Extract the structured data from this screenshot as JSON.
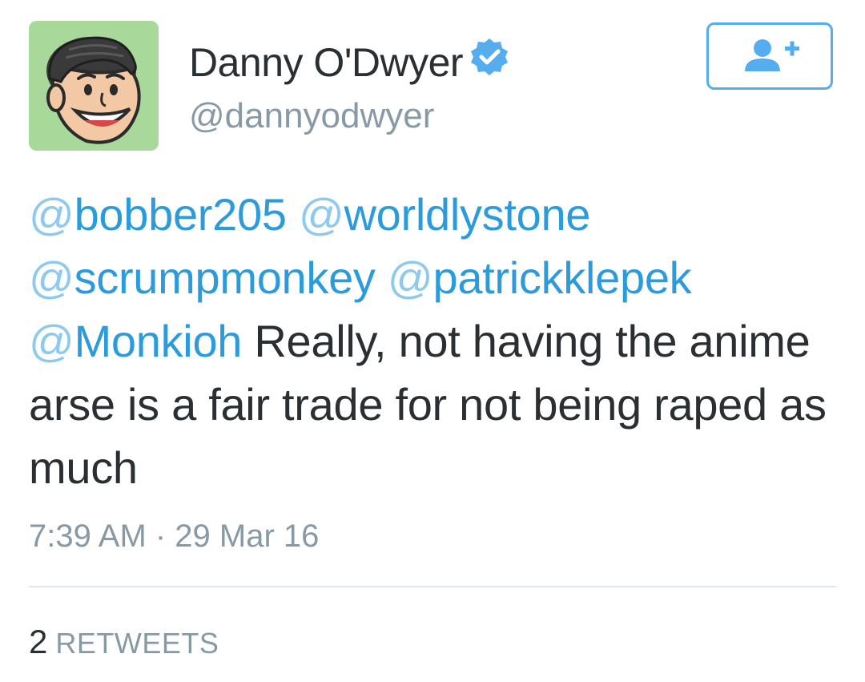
{
  "tweet": {
    "display_name": "Danny O'Dwyer",
    "handle": "@dannyodwyer",
    "verified": true,
    "mentions": [
      {
        "at": "@",
        "name": "bobber205"
      },
      {
        "at": "@",
        "name": "worldlystone"
      },
      {
        "at": "@",
        "name": "scrumpmonkey"
      },
      {
        "at": "@",
        "name": "patrickklepek"
      },
      {
        "at": "@",
        "name": "Monkioh"
      }
    ],
    "body": " Really, not having the anime arse is a fair trade for not being raped as much",
    "timestamp": "7:39 AM · 29 Mar 16",
    "retweet_count": "2",
    "retweet_label": "RETWEETS"
  },
  "icons": {
    "verified": "verified-badge-icon",
    "follow": "add-user-icon",
    "avatar": "cartoon-avatar"
  },
  "colors": {
    "link": "#2b9bdb",
    "link_at": "#8ec9ef",
    "text": "#292f33",
    "muted": "#8899a6",
    "accent": "#55acee",
    "avatar_bg": "#a8d89a",
    "divider": "#e1e8ed"
  }
}
